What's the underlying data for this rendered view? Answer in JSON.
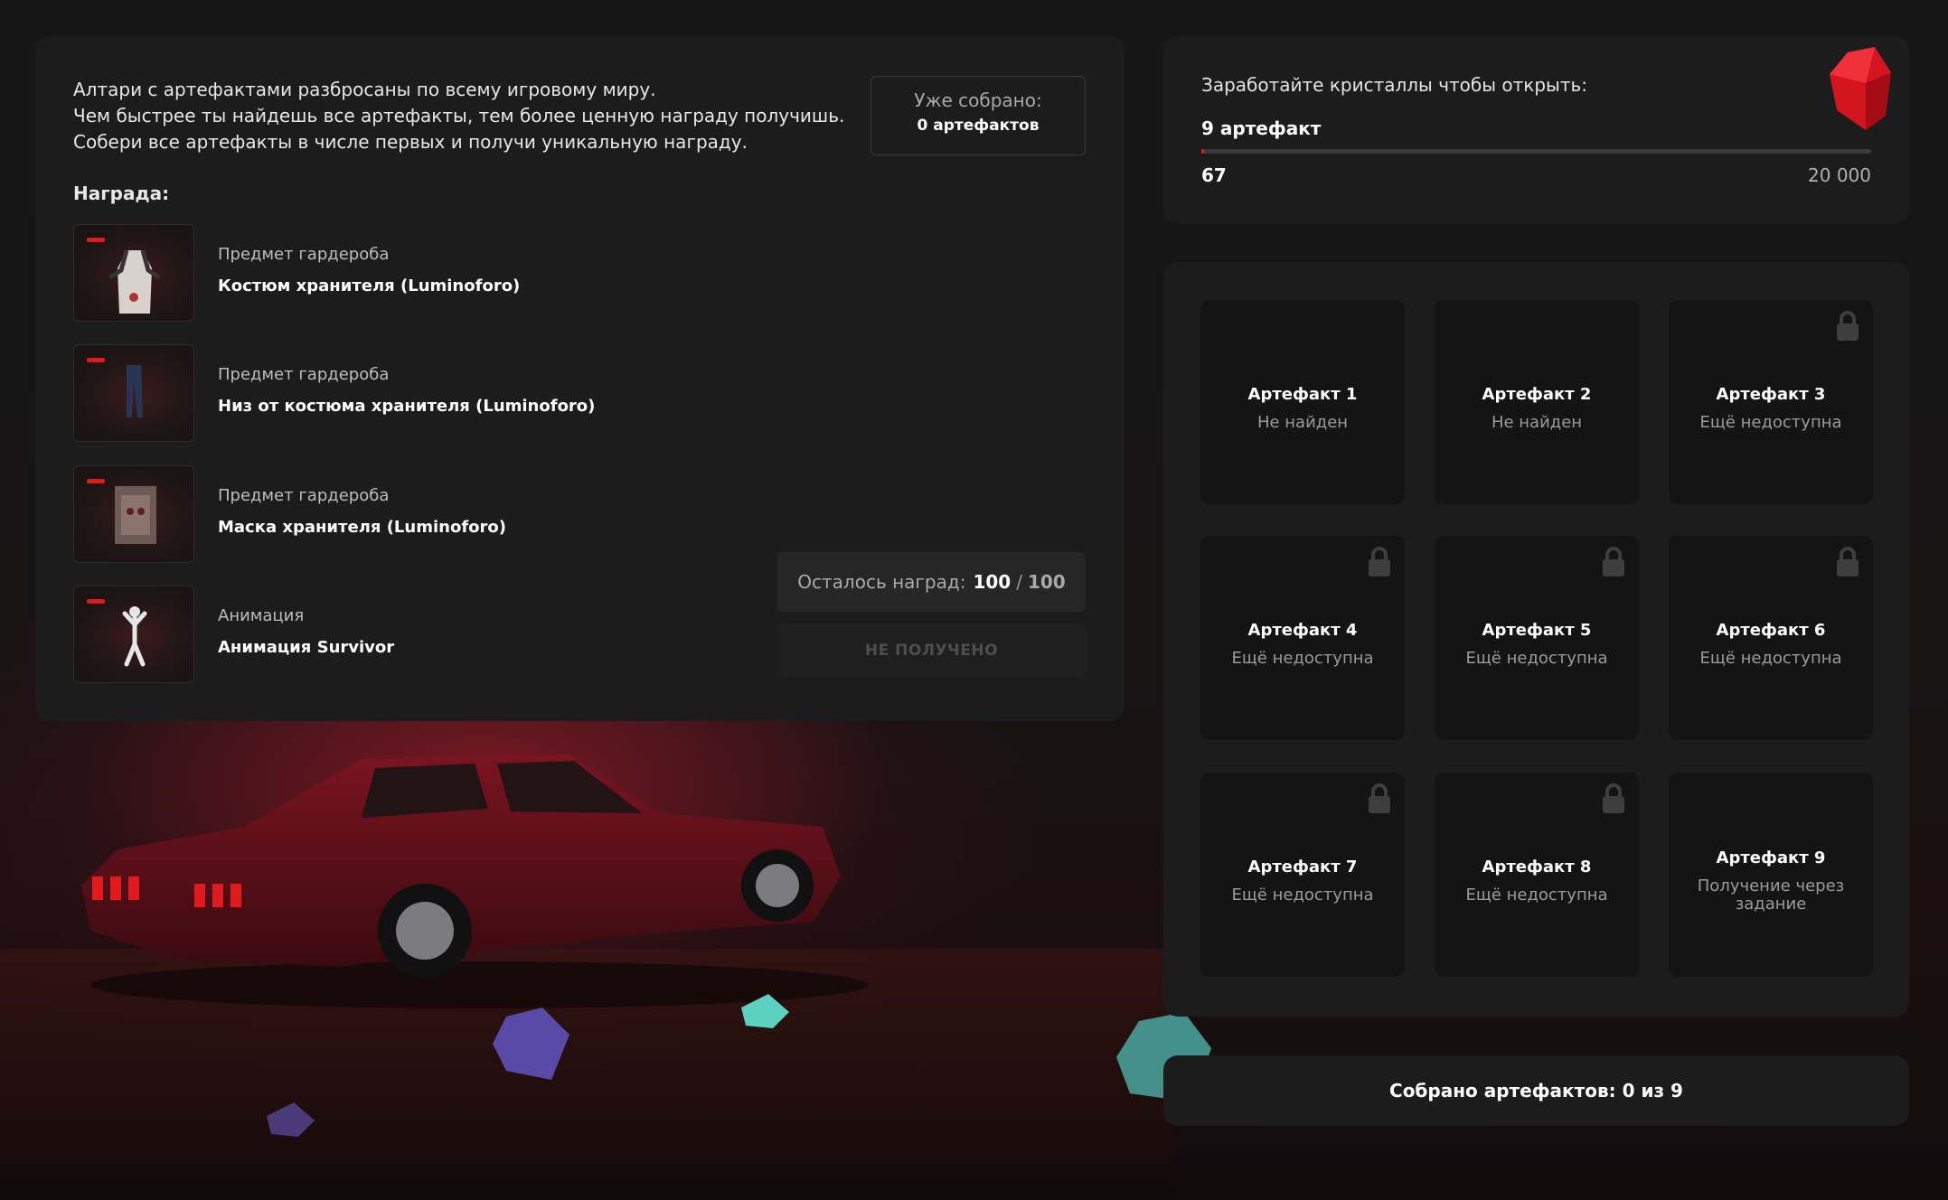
{
  "intro": {
    "line1": "Алтари с артефактами разбросаны по всему игровому миру.",
    "line2": "Чем быстрее ты найдешь все артефакты, тем более ценную награду получишь.",
    "line3": "Собери все артефакты в числе первых и получи уникальную награду."
  },
  "collected": {
    "label": "Уже собрано:",
    "value": "0 артефактов"
  },
  "rewards": {
    "title": "Награда:",
    "items": [
      {
        "category": "Предмет гардероба",
        "name": "Костюм хранителя (Luminoforo)"
      },
      {
        "category": "Предмет гардероба",
        "name": "Низ от костюма хранителя (Luminoforo)"
      },
      {
        "category": "Предмет гардероба",
        "name": "Маска хранителя (Luminoforo)"
      },
      {
        "category": "Анимация",
        "name": "Анимация Survivor"
      }
    ],
    "remaining_label": "Осталось наград:",
    "remaining_value": "100",
    "remaining_sep": "/",
    "remaining_total": "100",
    "claim_label": "НЕ ПОЛУЧЕНО"
  },
  "progress": {
    "earn_label": "Заработайте кристаллы чтобы открыть:",
    "target": "9 артефакт",
    "current": "67",
    "max": "20 000",
    "fraction": 0.00335
  },
  "artifacts": [
    {
      "title": "Артефакт 1",
      "status": "Не найден",
      "locked": false
    },
    {
      "title": "Артефакт 2",
      "status": "Не найден",
      "locked": false
    },
    {
      "title": "Артефакт 3",
      "status": "Ещё недоступна",
      "locked": true
    },
    {
      "title": "Артефакт 4",
      "status": "Ещё недоступна",
      "locked": true
    },
    {
      "title": "Артефакт 5",
      "status": "Ещё недоступна",
      "locked": true
    },
    {
      "title": "Артефакт 6",
      "status": "Ещё недоступна",
      "locked": true
    },
    {
      "title": "Артефакт 7",
      "status": "Ещё недоступна",
      "locked": true
    },
    {
      "title": "Артефакт 8",
      "status": "Ещё недоступна",
      "locked": true
    },
    {
      "title": "Артефакт 9",
      "status": "Получение через задание",
      "locked": false
    }
  ],
  "footer": {
    "text": "Собрано артефактов: 0 из 9"
  },
  "colors": {
    "accent": "#e02121",
    "panel": "#1c1c1c",
    "tile": "#141414"
  }
}
